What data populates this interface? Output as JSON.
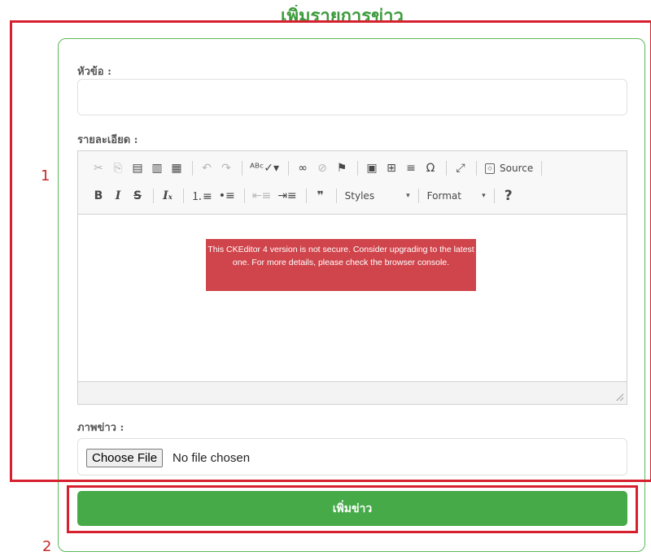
{
  "page": {
    "title": "เพิ่มรายการข่าว"
  },
  "form": {
    "title_label": "หัวข้อ :",
    "title_value": "",
    "detail_label": "รายละเอียด :",
    "image_label": "ภาพข่าว :",
    "choose_file_label": "Choose File",
    "no_file_text": "No file chosen",
    "submit_label": "เพิ่มข่าว"
  },
  "editor": {
    "toolbar_row1": [
      {
        "name": "cut-icon",
        "glyph": "✂",
        "dim": true
      },
      {
        "name": "copy-icon",
        "glyph": "⎘",
        "dim": true
      },
      {
        "name": "paste-icon",
        "glyph": "▤",
        "dim": false
      },
      {
        "name": "paste-text-icon",
        "glyph": "▥",
        "dim": false
      },
      {
        "name": "paste-word-icon",
        "glyph": "▦",
        "dim": false
      },
      {
        "sep": true
      },
      {
        "name": "undo-icon",
        "glyph": "↶",
        "dim": true
      },
      {
        "name": "redo-icon",
        "glyph": "↷",
        "dim": true
      },
      {
        "sep": true
      },
      {
        "name": "spellcheck-icon",
        "glyph": "ᴬᴮᶜ✓▾",
        "dim": false
      },
      {
        "sep": true
      },
      {
        "name": "link-icon",
        "glyph": "∞",
        "dim": false
      },
      {
        "name": "unlink-icon",
        "glyph": "⊘",
        "dim": true
      },
      {
        "name": "anchor-flag-icon",
        "glyph": "⚑",
        "dim": false
      },
      {
        "sep": true
      },
      {
        "name": "image-icon",
        "glyph": "▣",
        "dim": false
      },
      {
        "name": "table-icon",
        "glyph": "⊞",
        "dim": false
      },
      {
        "name": "horizontal-rule-icon",
        "glyph": "≡",
        "dim": false
      },
      {
        "name": "special-char-icon",
        "glyph": "Ω",
        "dim": false
      },
      {
        "sep": true
      },
      {
        "name": "maximize-icon",
        "glyph": "⤢",
        "dim": false
      },
      {
        "sep": true
      }
    ],
    "source_label": "Source",
    "toolbar_row2": [
      {
        "name": "bold-icon",
        "glyph": "B",
        "style": "bold"
      },
      {
        "name": "italic-icon",
        "glyph": "I",
        "style": "italic"
      },
      {
        "name": "strikethrough-icon",
        "glyph": "S",
        "style": "strike"
      },
      {
        "sep": true
      },
      {
        "name": "remove-format-icon",
        "glyph": "Iₓ",
        "style": "italic"
      },
      {
        "sep": true
      },
      {
        "name": "numbered-list-icon",
        "glyph": "⒈≡",
        "style": ""
      },
      {
        "name": "bulleted-list-icon",
        "glyph": "•≡",
        "style": ""
      },
      {
        "sep": true
      },
      {
        "name": "outdent-icon",
        "glyph": "⇤≡",
        "style": "dim"
      },
      {
        "name": "indent-icon",
        "glyph": "⇥≡",
        "style": ""
      },
      {
        "sep": true
      },
      {
        "name": "blockquote-icon",
        "glyph": "❞",
        "style": "bold"
      },
      {
        "sep": true
      }
    ],
    "styles_label": "Styles",
    "format_label": "Format",
    "help_glyph": "?",
    "warning_text": "This CKEditor 4 version is not secure. Consider upgrading to the latest one. For more details, please check the browser console."
  },
  "annotations": {
    "label_1": "1",
    "label_2": "2"
  },
  "colors": {
    "accent_green": "#46aa49",
    "annotation_red": "#d6202e",
    "warning_red": "#d0454c"
  }
}
